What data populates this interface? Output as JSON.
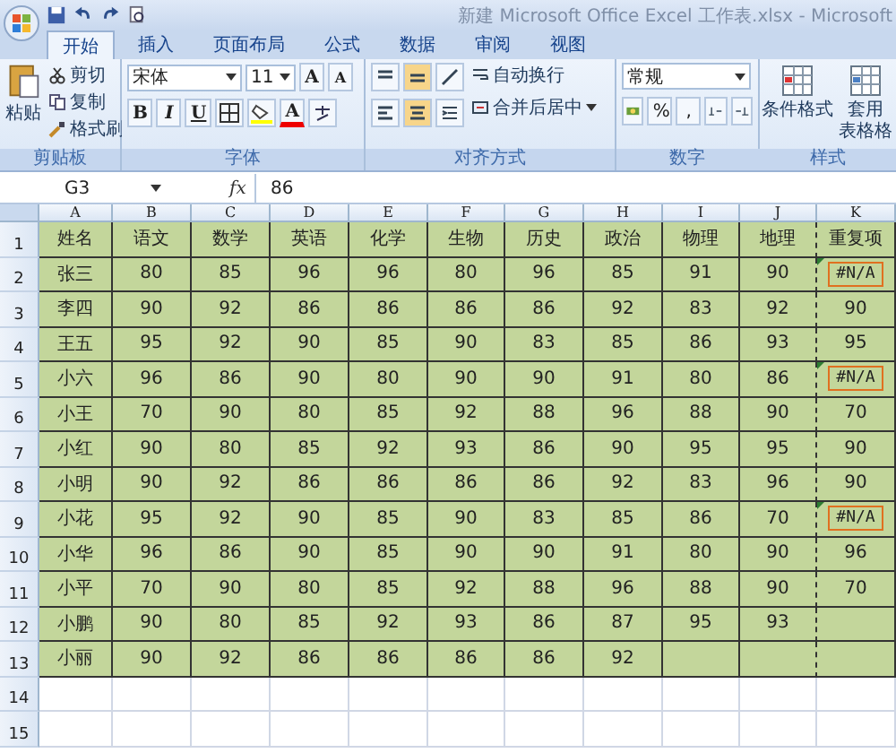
{
  "window": {
    "title": "新建 Microsoft Office Excel 工作表.xlsx - Microsoft"
  },
  "tabs": [
    {
      "label": "开始",
      "selected": true
    },
    {
      "label": "插入",
      "selected": false
    },
    {
      "label": "页面布局",
      "selected": false
    },
    {
      "label": "公式",
      "selected": false
    },
    {
      "label": "数据",
      "selected": false
    },
    {
      "label": "审阅",
      "selected": false
    },
    {
      "label": "视图",
      "selected": false
    }
  ],
  "clipboard": {
    "label": "剪贴板",
    "paste": "粘贴",
    "items": [
      "剪切",
      "复制",
      "格式刷"
    ]
  },
  "font": {
    "label": "字体",
    "family": "宋体",
    "size": "11",
    "grow": "A",
    "shrink": "A",
    "styles": [
      "B",
      "I",
      "U"
    ],
    "color_button": "A"
  },
  "alignment": {
    "label": "对齐方式",
    "wrap": "自动换行",
    "merge": "合并后居中"
  },
  "number": {
    "label": "数字",
    "format": "常规",
    "symbols": [
      "%",
      ","
    ]
  },
  "styles": {
    "label": "样式",
    "items": [
      "条件格式",
      "套用"
    ],
    "item_2_line_2": "表格格"
  },
  "formula_bar": {
    "cell": "G3",
    "fx": "fx",
    "value": "86"
  },
  "sheet": {
    "columns": [
      "A",
      "B",
      "C",
      "D",
      "E",
      "F",
      "G",
      "H",
      "I",
      "J",
      "K"
    ],
    "rows": [
      {
        "number": "1",
        "flagged": false,
        "cells": [
          "姓名",
          "语文",
          "数学",
          "英语",
          "化学",
          "生物",
          "历史",
          "政治",
          "物理",
          "地理",
          "重复项"
        ]
      },
      {
        "number": "2",
        "flagged": true,
        "cells": [
          "张三",
          "80",
          "85",
          "96",
          "96",
          "80",
          "96",
          "85",
          "91",
          "90",
          "#N/A"
        ]
      },
      {
        "number": "3",
        "flagged": false,
        "cells": [
          "李四",
          "90",
          "92",
          "86",
          "86",
          "86",
          "86",
          "92",
          "83",
          "92",
          "90"
        ]
      },
      {
        "number": "4",
        "flagged": false,
        "cells": [
          "王五",
          "95",
          "92",
          "90",
          "85",
          "90",
          "83",
          "85",
          "86",
          "93",
          "95"
        ]
      },
      {
        "number": "5",
        "flagged": true,
        "cells": [
          "小六",
          "96",
          "86",
          "90",
          "80",
          "90",
          "90",
          "91",
          "80",
          "86",
          "#N/A"
        ]
      },
      {
        "number": "6",
        "flagged": false,
        "cells": [
          "小王",
          "70",
          "90",
          "80",
          "85",
          "92",
          "88",
          "96",
          "88",
          "90",
          "70"
        ]
      },
      {
        "number": "7",
        "flagged": false,
        "cells": [
          "小红",
          "90",
          "80",
          "85",
          "92",
          "93",
          "86",
          "90",
          "95",
          "95",
          "90"
        ]
      },
      {
        "number": "8",
        "flagged": false,
        "cells": [
          "小明",
          "90",
          "92",
          "86",
          "86",
          "86",
          "86",
          "92",
          "83",
          "96",
          "90"
        ]
      },
      {
        "number": "9",
        "flagged": true,
        "cells": [
          "小花",
          "95",
          "92",
          "90",
          "85",
          "90",
          "83",
          "85",
          "86",
          "70",
          "#N/A"
        ]
      },
      {
        "number": "10",
        "flagged": false,
        "cells": [
          "小华",
          "96",
          "86",
          "90",
          "85",
          "90",
          "90",
          "91",
          "80",
          "90",
          "96"
        ]
      },
      {
        "number": "11",
        "flagged": false,
        "cells": [
          "小平",
          "70",
          "90",
          "80",
          "85",
          "92",
          "88",
          "96",
          "88",
          "90",
          "70"
        ]
      },
      {
        "number": "12",
        "flagged": false,
        "cells": [
          "小鹏",
          "90",
          "80",
          "85",
          "92",
          "93",
          "86",
          "87",
          "95",
          "93"
        ]
      },
      {
        "number": "13",
        "flagged": false,
        "cells": [
          "小丽",
          "90",
          "92",
          "86",
          "86",
          "86",
          "86",
          "92"
        ]
      }
    ],
    "empty_rows": [
      "14",
      "15"
    ]
  }
}
